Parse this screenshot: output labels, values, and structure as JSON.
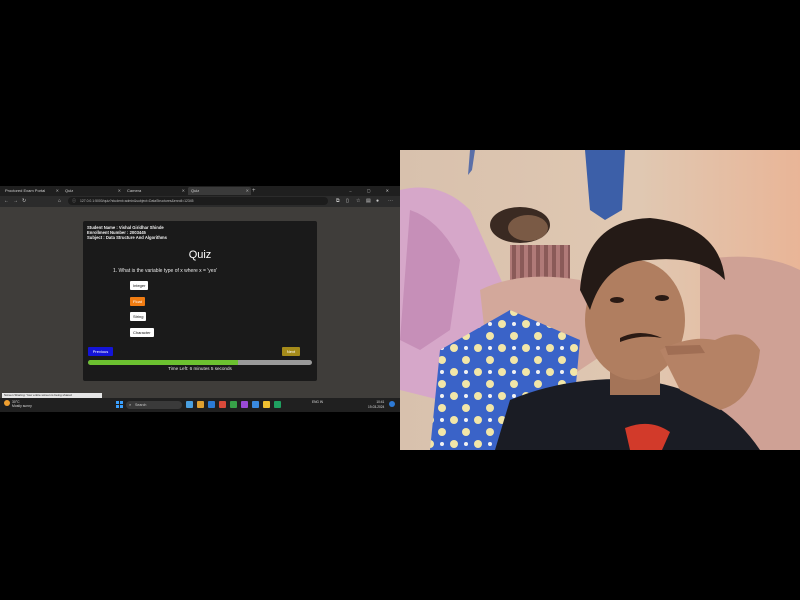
{
  "browser": {
    "tabs": [
      {
        "label": "Proctored Exam Portal",
        "active": false
      },
      {
        "label": "Quiz",
        "active": false
      },
      {
        "label": "Camera",
        "active": false
      },
      {
        "label": "Quiz",
        "active": true
      }
    ],
    "new_tab_icon": "plus-icon",
    "window_controls": "–  ▢  ✕",
    "url": "127.0.0.1:5000/quiz?student=admin&subject=DataStructures&enroll=12345"
  },
  "quiz": {
    "student_name": "Student Name : Vishal Giridhar Shinde",
    "enrollment": "Enrollment Number : 2003445",
    "subject": "Subject : Data Structure And Algorithms",
    "title": "Quiz",
    "question": "1. What is the variable type of x where x = 'yes'",
    "options": [
      {
        "label": "Integer",
        "selected": false
      },
      {
        "label": "Float",
        "selected": true
      },
      {
        "label": "String",
        "selected": false
      },
      {
        "label": "Character",
        "selected": false
      }
    ],
    "previous_label": "Previous",
    "next_label": "Next",
    "progress_fraction": 0.67,
    "time_left": "Time Left: 6 minutes 5 seconds",
    "colors": {
      "selected_option": "#f07c12",
      "previous_button": "#1414d9",
      "next_button": "#a58b1a",
      "progress": "#6cc130"
    }
  },
  "status_strip": "Screen Sharing: Your entire screen is being shared",
  "taskbar": {
    "weather": "30°C",
    "weather_sub": "Mostly sunny",
    "search_placeholder": "Search",
    "tray": "ENG  IN",
    "time": "10:41",
    "date": "19-03-2024"
  },
  "webcam": {
    "description_icon": "webcam-feed"
  }
}
